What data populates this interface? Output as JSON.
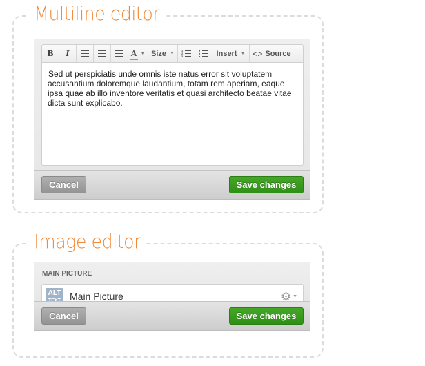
{
  "multiline_editor": {
    "title": "Multiline editor",
    "toolbar": {
      "bold_label": "B",
      "italic_label": "I",
      "align_left_icon": "align-left-icon",
      "align_center_icon": "align-center-icon",
      "align_right_icon": "align-right-icon",
      "text_color_label": "A",
      "text_color_swatch": "#f06b8f",
      "size_label": "Size",
      "ordered_list_icon": "ordered-list-icon",
      "unordered_list_icon": "unordered-list-icon",
      "insert_label": "Insert",
      "source_icon": "<>",
      "source_label": "Source",
      "caret": "▼"
    },
    "content": "Sed ut perspiciatis unde omnis iste natus error sit voluptatem accusantium doloremque laudantium, totam rem aperiam, eaque ipsa quae ab illo inventore veritatis et quasi architecto beatae vitae dicta sunt explicabo.",
    "cancel_label": "Cancel",
    "save_label": "Save changes"
  },
  "image_editor": {
    "title": "Image editor",
    "field_label": "MAIN PICTURE",
    "alt_badge_top": "ALT",
    "alt_badge_bottom": "TEXT",
    "picture_name": "Main Picture",
    "settings_icon": "⚙",
    "caret": "▼",
    "cancel_label": "Cancel",
    "save_label": "Save changes"
  },
  "colors": {
    "title_accent": "#f08a3a",
    "save_green": "#3a9b1f",
    "cancel_gray": "#a3a3a3",
    "alt_badge": "#9fb4c9"
  }
}
